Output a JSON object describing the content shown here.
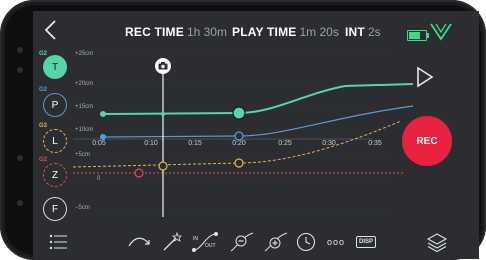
{
  "header": {
    "rec_time_label": "REC TIME",
    "rec_time_value": "1h 30m",
    "play_time_label": "PLAY TIME",
    "play_time_value": "1m 20s",
    "int_label": "INT",
    "int_value": "2s",
    "battery_level_percent": 70,
    "accent_color": "#3ddc84"
  },
  "axes": [
    {
      "id": "T",
      "label": "T",
      "group": "G2",
      "color": "#55d6a8",
      "filled": true
    },
    {
      "id": "P",
      "label": "P",
      "group": "G2",
      "color": "#5a9ad6",
      "filled": false
    },
    {
      "id": "L",
      "label": "L",
      "group": "G3",
      "color": "#e8b44a",
      "filled": false
    },
    {
      "id": "Z",
      "label": "Z",
      "group": "G2",
      "color": "#e04d4d",
      "filled": false
    },
    {
      "id": "F",
      "label": "F",
      "group": "",
      "color": "#d9d9d9",
      "filled": false
    }
  ],
  "left_ticks": [
    "+25cm",
    "+20cm",
    "+15cm",
    "+10cm",
    "+5cm",
    "0",
    "−5cm"
  ],
  "timeline": {
    "ticks": [
      "0:05",
      "0:10",
      "0:15",
      "0:20",
      "0:25",
      "0:30",
      "0:35"
    ],
    "playhead_icon": "camera-icon"
  },
  "controls": {
    "play_icon": "play-icon",
    "rec_label": "REC",
    "rec_color": "#e8223f"
  },
  "toolbar": {
    "in_label": "IN",
    "out_label": "OUT",
    "more_label": "ooo",
    "disp_label": "DISP",
    "icons": [
      "list-icon",
      "curve-arrow-icon",
      "magic-wand-icon",
      "in-out-icon",
      "remove-keyframe-icon",
      "add-keyframe-icon",
      "clock-icon",
      "more-icon",
      "disp-icon",
      "layers-icon"
    ]
  }
}
